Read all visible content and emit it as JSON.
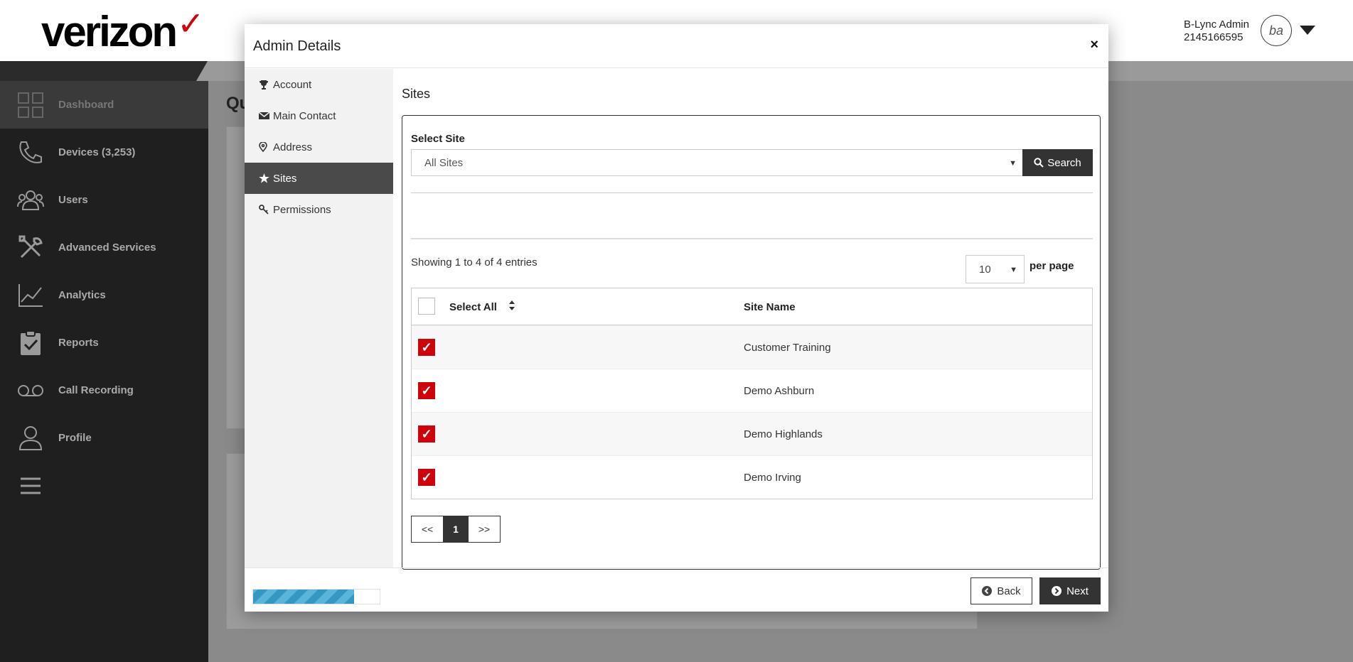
{
  "app": {
    "logo_text": "verizon",
    "logo_mark": "✓",
    "user_name": "B-Lync Admin",
    "user_phone": "2145166595",
    "user_initials": "ba",
    "page_title_partial": "Qu"
  },
  "sidebar": {
    "items": [
      {
        "label": "Dashboard",
        "icon": "dashboard-icon"
      },
      {
        "label": "Devices (3,253)",
        "icon": "phone-icon"
      },
      {
        "label": "Users",
        "icon": "users-icon"
      },
      {
        "label": "Advanced Services",
        "icon": "tools-icon"
      },
      {
        "label": "Analytics",
        "icon": "analytics-icon"
      },
      {
        "label": "Reports",
        "icon": "clipboard-icon"
      },
      {
        "label": "Call Recording",
        "icon": "voicemail-icon"
      },
      {
        "label": "Profile",
        "icon": "profile-icon"
      }
    ],
    "menu_icon": "hamburger-icon"
  },
  "modal": {
    "title": "Admin Details",
    "close": "×",
    "nav": [
      {
        "label": "Account",
        "icon": "trophy-icon"
      },
      {
        "label": "Main Contact",
        "icon": "envelope-icon"
      },
      {
        "label": "Address",
        "icon": "map-marker-icon"
      },
      {
        "label": "Sites",
        "icon": "star-icon",
        "active": true
      },
      {
        "label": "Permissions",
        "icon": "key-icon"
      }
    ],
    "progress_percent": 80,
    "section_title": "Sites",
    "select_site_label": "Select Site",
    "select_site_value": "All Sites",
    "search_label": "Search",
    "showing_text": "Showing 1 to 4 of 4 entries",
    "per_page_value": "10",
    "per_page_label": "per page",
    "table": {
      "col_select_all": "Select All",
      "col_site_name": "Site Name",
      "select_all_checked": false,
      "rows": [
        {
          "checked": true,
          "site": "Customer Training"
        },
        {
          "checked": true,
          "site": "Demo Ashburn"
        },
        {
          "checked": true,
          "site": "Demo Highlands"
        },
        {
          "checked": true,
          "site": "Demo Irving"
        }
      ]
    },
    "pagination": {
      "prev": "<<",
      "current": "1",
      "next": ">>"
    },
    "back_label": "Back",
    "next_label": "Next",
    "check_glyph": "✓"
  },
  "colors": {
    "brand_red": "#cd040b",
    "dark": "#333333",
    "progress": "#3498c3"
  }
}
